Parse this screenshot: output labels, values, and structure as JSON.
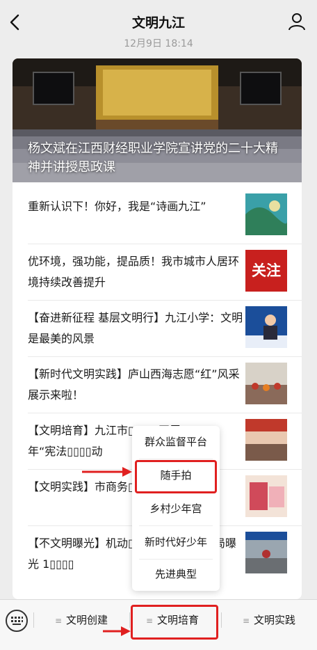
{
  "header": {
    "title": "文明九江",
    "timestamp": "12月9日 18:14"
  },
  "hero": {
    "title": "杨文斌在江西财经职业学院宣讲党的二十大精神并讲授思政课"
  },
  "articles": [
    {
      "title": "重新认识下！你好，我是“诗画九江”"
    },
    {
      "title": "优环境，强功能，提品质！我市城市人居环境持续改善提升",
      "thumb_text": "关注"
    },
    {
      "title": "【奋进新征程 基层文明行】九江小学：文明是最美的风景"
    },
    {
      "title": "【新时代文明实践】庐山西海志愿“红”风采展示来啦！"
    },
    {
      "title": "【文明培育】九江市▯▯▯▯▯开展 2022 年“宪法▯▯▯▯动"
    },
    {
      "title": "【文明实践】市商务▯▯▯▯▯暖”关爱活动"
    },
    {
      "title": "【不文明曝光】机动▯▯▯▯▯圾！市城管局曝光 1▯▯▯▯"
    }
  ],
  "popup_menu": {
    "items": [
      "群众监督平台",
      "随手拍",
      "乡村少年宫",
      "新时代好少年",
      "先进典型"
    ]
  },
  "tabbar": {
    "tabs": [
      "文明创建",
      "文明培育",
      "文明实践"
    ]
  },
  "colors": {
    "highlight": "#e02020",
    "accent_red": "#c8201e"
  }
}
